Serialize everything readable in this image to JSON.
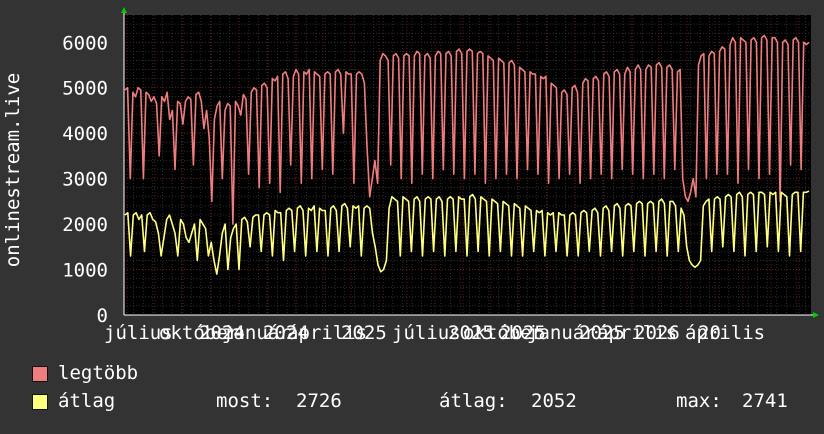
{
  "chart_data": {
    "type": "line",
    "ylabel": "onlinestream.live",
    "ylim": [
      0,
      6600
    ],
    "yticks": [
      "0",
      "1000",
      "2000",
      "3000",
      "4000",
      "5000",
      "6000"
    ],
    "xtick_labels": [
      "július",
      "október",
      "2024",
      "január",
      "2024",
      "április",
      "2025",
      "július",
      "2025",
      "október",
      "2025",
      "január",
      "2025",
      "április",
      "2026",
      "április",
      "20"
    ],
    "grid": true,
    "legend_placement": "bottom-left",
    "series": [
      {
        "name": "legtöbb",
        "color": "#f07d7d",
        "values": [
          4950,
          5000,
          3000,
          4900,
          4800,
          5000,
          4950,
          3000,
          4900,
          4850,
          4700,
          4800,
          4650,
          3500,
          4800,
          4700,
          4900,
          4300,
          4500,
          3200,
          4700,
          4650,
          4200,
          4700,
          4800,
          4750,
          3300,
          4850,
          4900,
          4700,
          4100,
          4500,
          3900,
          2500,
          4300,
          4600,
          4700,
          3000,
          4500,
          4650,
          4600,
          2000,
          4700,
          4600,
          4400,
          4850,
          4750,
          3100,
          4900,
          5000,
          4950,
          2800,
          5050,
          5100,
          5000,
          2900,
          5200,
          5150,
          5250,
          2700,
          5300,
          5350,
          5200,
          3300,
          5250,
          5400,
          5300,
          2900,
          5350,
          5300,
          5400,
          3000,
          5350,
          5300,
          5250,
          3200,
          5300,
          5350,
          5300,
          3100,
          5350,
          5400,
          5300,
          4000,
          5350,
          5300,
          5300,
          2900,
          5300,
          5350,
          5300,
          5100,
          3700,
          2600,
          3000,
          3400,
          2900,
          5600,
          5750,
          5700,
          5600,
          3300,
          5700,
          5750,
          5650,
          3000,
          5700,
          5750,
          5700,
          2900,
          5700,
          5800,
          5750,
          3100,
          5700,
          5750,
          5650,
          3000,
          5700,
          5800,
          5750,
          3200,
          5750,
          5800,
          5700,
          3100,
          5800,
          5850,
          5750,
          3000,
          5800,
          5850,
          5800,
          3100,
          5750,
          5800,
          5750,
          2900,
          5700,
          5650,
          5600,
          3000,
          5650,
          5600,
          5550,
          3100,
          5550,
          5600,
          5500,
          3000,
          5450,
          5400,
          5350,
          3200,
          5350,
          5300,
          5300,
          3100,
          5250,
          5200,
          5250,
          2900,
          5100,
          5050,
          5000,
          3000,
          4900,
          4950,
          4850,
          3100,
          5000,
          5050,
          4900,
          2900,
          5100,
          5200,
          5150,
          3000,
          5200,
          5250,
          5150,
          3100,
          5300,
          5350,
          5250,
          3000,
          5350,
          5400,
          5300,
          3200,
          5300,
          5450,
          5350,
          3100,
          5400,
          5500,
          5400,
          3000,
          5400,
          5500,
          5450,
          3100,
          5500,
          5550,
          5450,
          3000,
          5450,
          5500,
          5400,
          3200,
          5350,
          5400,
          3000,
          2600,
          2500,
          2700,
          3000,
          2600,
          5500,
          5700,
          5750,
          3000,
          5700,
          5800,
          5750,
          3100,
          5800,
          5900,
          5850,
          3100,
          5950,
          6100,
          6000,
          2900,
          6100,
          6050,
          6000,
          3200,
          6050,
          6100,
          6000,
          3000,
          6100,
          6150,
          6050,
          3100,
          6100,
          6100,
          6000,
          2500,
          6000,
          6050,
          5950,
          3300,
          6050,
          6100,
          6000,
          3200,
          6000,
          5950,
          6000
        ]
      },
      {
        "name": "átlag",
        "color": "#ffff80",
        "values": [
          2200,
          2250,
          1300,
          2200,
          2250,
          2100,
          2200,
          1400,
          2200,
          2250,
          2100,
          2050,
          1800,
          1300,
          1700,
          2100,
          2200,
          2000,
          1800,
          1300,
          2100,
          2000,
          1700,
          1600,
          1800,
          2000,
          1200,
          2100,
          2000,
          1900,
          1300,
          1600,
          1200,
          900,
          1300,
          1800,
          2000,
          1000,
          1700,
          1900,
          2000,
          1000,
          2100,
          2150,
          2050,
          1500,
          2150,
          2200,
          2200,
          1400,
          2200,
          2250,
          2200,
          1300,
          2300,
          2250,
          2250,
          1200,
          2300,
          2350,
          2300,
          1400,
          2350,
          2400,
          2300,
          1300,
          2350,
          2300,
          2400,
          1400,
          2350,
          2300,
          2300,
          1300,
          2350,
          2400,
          2300,
          1400,
          2400,
          2450,
          2350,
          1500,
          2400,
          2350,
          2400,
          1300,
          2350,
          2400,
          2350,
          1800,
          1500,
          1100,
          950,
          1000,
          1200,
          2350,
          2600,
          2550,
          2500,
          1300,
          2600,
          2550,
          2500,
          1400,
          2550,
          2600,
          2500,
          1300,
          2550,
          2600,
          2550,
          1400,
          2550,
          2600,
          2500,
          1300,
          2550,
          2600,
          2550,
          1400,
          2600,
          2550,
          2550,
          1300,
          2600,
          2650,
          2550,
          1400,
          2600,
          2550,
          2500,
          1300,
          2550,
          2500,
          2450,
          1400,
          2500,
          2450,
          2400,
          1300,
          2450,
          2400,
          2350,
          1300,
          2400,
          2350,
          2300,
          1400,
          2300,
          2250,
          2300,
          1300,
          2250,
          2200,
          2250,
          1400,
          2250,
          2200,
          2200,
          1300,
          2200,
          2250,
          2200,
          1300,
          2250,
          2300,
          2250,
          1400,
          2300,
          2350,
          2250,
          1300,
          2350,
          2400,
          2300,
          1400,
          2400,
          2450,
          2350,
          1300,
          2400,
          2450,
          2400,
          1400,
          2450,
          2500,
          2450,
          1300,
          2450,
          2500,
          2450,
          1400,
          2500,
          2550,
          2450,
          1300,
          2500,
          2500,
          2400,
          1400,
          2350,
          2200,
          1500,
          1200,
          1100,
          1050,
          1100,
          1200,
          2400,
          2500,
          2550,
          1400,
          2550,
          2600,
          2550,
          1500,
          2600,
          2650,
          2600,
          1400,
          2650,
          2700,
          2600,
          1300,
          2650,
          2700,
          2650,
          1400,
          2700,
          2700,
          2650,
          1500,
          2700,
          2650,
          2700,
          1400,
          2700,
          2650,
          2600,
          1300,
          2650,
          2700,
          2700,
          1400,
          2700,
          2700,
          2726
        ]
      }
    ]
  },
  "legend": {
    "items": [
      {
        "label": "legtöbb",
        "color": "#f07d7d"
      },
      {
        "label": "átlag",
        "color": "#ffff80"
      }
    ],
    "stats": {
      "now_label": "most:",
      "now_value": "2726",
      "avg_label": "átlag:",
      "avg_value": "2052",
      "max_label": "max:",
      "max_value": "2741"
    }
  },
  "colors": {
    "background": "#333333",
    "plot_background": "#000000",
    "grid_major": "#7a1f1f",
    "grid_minor": "#4a4a4a",
    "axis": "#ffffff",
    "arrow": "#00cc00"
  }
}
